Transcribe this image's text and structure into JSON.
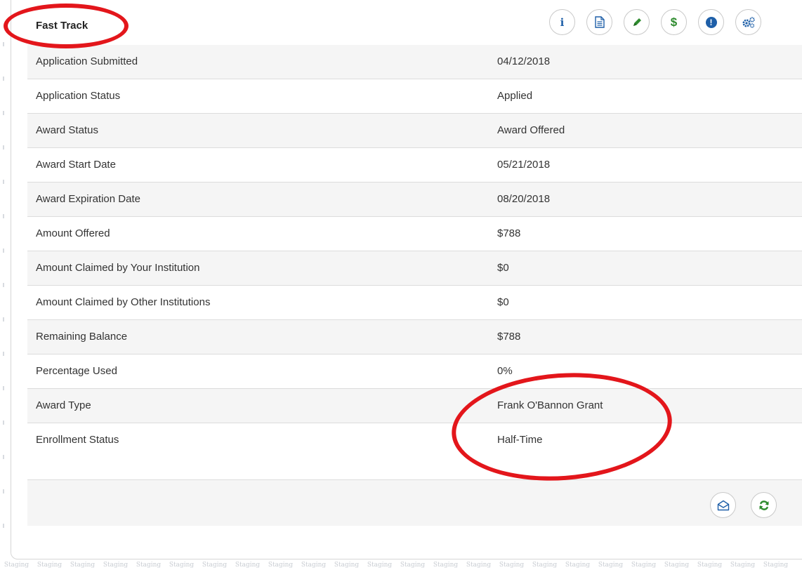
{
  "panel": {
    "title": "Fast Track"
  },
  "toolbar": {
    "icons": [
      "info-icon",
      "document-icon",
      "pencil-icon",
      "dollar-icon",
      "alert-icon",
      "settings-icon"
    ],
    "info_glyph": "i",
    "dollar_glyph": "$",
    "alert_glyph": "!"
  },
  "rows": [
    {
      "label": "Application Submitted",
      "value": "04/12/2018"
    },
    {
      "label": "Application Status",
      "value": "Applied"
    },
    {
      "label": "Award Status",
      "value": "Award Offered"
    },
    {
      "label": "Award Start Date",
      "value": "05/21/2018"
    },
    {
      "label": "Award Expiration Date",
      "value": "08/20/2018"
    },
    {
      "label": "Amount Offered",
      "value": "$788"
    },
    {
      "label": "Amount Claimed by Your Institution",
      "value": "$0"
    },
    {
      "label": "Amount Claimed by Other Institutions",
      "value": "$0"
    },
    {
      "label": "Remaining Balance",
      "value": "$788"
    },
    {
      "label": "Percentage Used",
      "value": "0%"
    },
    {
      "label": "Award Type",
      "value": "Frank O'Bannon Grant"
    },
    {
      "label": "Enrollment Status",
      "value": "Half-Time"
    }
  ],
  "footer": {
    "icons": [
      "envelope-open-icon",
      "refresh-icon"
    ]
  },
  "watermark": {
    "text": "Staging"
  },
  "colors": {
    "annotation": "#e3161b",
    "accent_blue": "#1e5fa8",
    "accent_green": "#2e8b2e"
  }
}
